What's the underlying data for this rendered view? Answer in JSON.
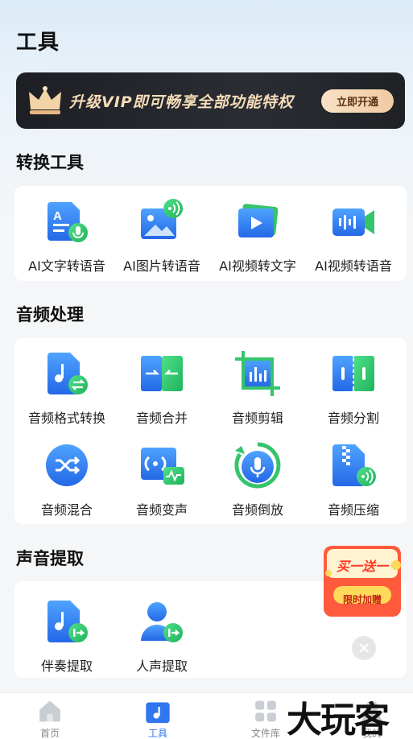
{
  "page": {
    "title": "工具"
  },
  "vip": {
    "text": "升级VIP即可畅享全部功能特权",
    "button": "立即开通"
  },
  "sections": [
    {
      "title": "转换工具",
      "tools": [
        {
          "label": "AI文字转语音",
          "icon": "text-to-speech-icon"
        },
        {
          "label": "AI图片转语音",
          "icon": "image-to-speech-icon"
        },
        {
          "label": "AI视频转文字",
          "icon": "video-to-text-icon"
        },
        {
          "label": "AI视频转语音",
          "icon": "video-to-speech-icon"
        }
      ]
    },
    {
      "title": "音频处理",
      "tools": [
        {
          "label": "音频格式转换",
          "icon": "audio-format-convert-icon"
        },
        {
          "label": "音频合并",
          "icon": "audio-merge-icon"
        },
        {
          "label": "音频剪辑",
          "icon": "audio-cut-icon"
        },
        {
          "label": "音频分割",
          "icon": "audio-split-icon"
        },
        {
          "label": "音频混合",
          "icon": "audio-mix-icon"
        },
        {
          "label": "音频变声",
          "icon": "voice-change-icon"
        },
        {
          "label": "音频倒放",
          "icon": "audio-reverse-icon"
        },
        {
          "label": "音频压缩",
          "icon": "audio-compress-icon"
        }
      ]
    },
    {
      "title": "声音提取",
      "tools": [
        {
          "label": "伴奏提取",
          "icon": "accompaniment-extract-icon"
        },
        {
          "label": "人声提取",
          "icon": "vocal-extract-icon"
        }
      ]
    }
  ],
  "promo": {
    "top_text": "买一送一",
    "bottom_text": "限时加赠"
  },
  "nav": [
    {
      "label": "首页",
      "icon": "home-icon",
      "active": false
    },
    {
      "label": "工具",
      "icon": "tools-icon",
      "active": true
    },
    {
      "label": "文件库",
      "icon": "files-icon",
      "active": false
    },
    {
      "label": "我的",
      "icon": "profile-icon",
      "active": false
    }
  ],
  "watermark": "大玩客",
  "colors": {
    "accent": "#2f76f0",
    "icon_blue": "#3b82f6",
    "icon_green": "#35c46a",
    "promo_red": "#ff4f3f",
    "vip_gold": "#f6dcb8"
  }
}
